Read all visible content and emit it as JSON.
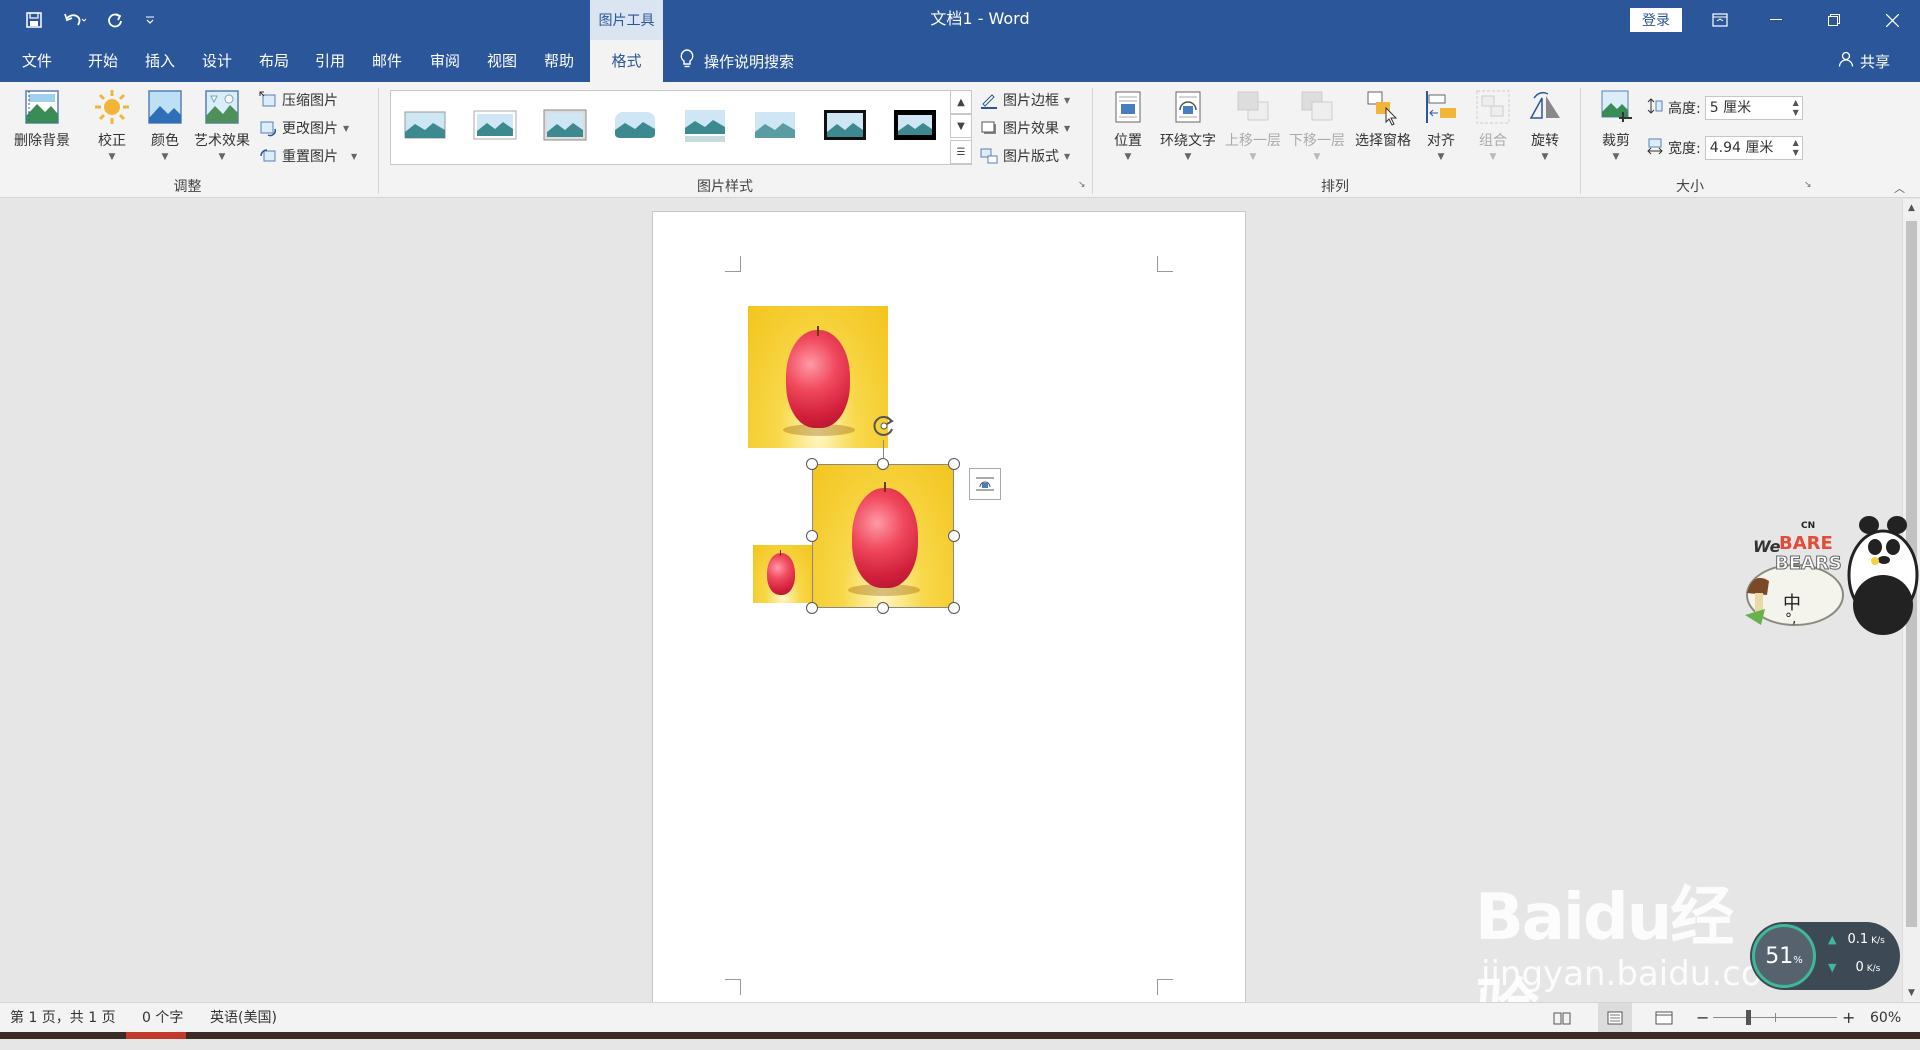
{
  "titlebar": {
    "context_tool_label": "图片工具",
    "doc_title": "文档1  -  Word",
    "login_label": "登录"
  },
  "tabs": [
    {
      "label": "文件"
    },
    {
      "label": "开始"
    },
    {
      "label": "插入"
    },
    {
      "label": "设计"
    },
    {
      "label": "布局"
    },
    {
      "label": "引用"
    },
    {
      "label": "邮件"
    },
    {
      "label": "审阅"
    },
    {
      "label": "视图"
    },
    {
      "label": "帮助"
    },
    {
      "label": "格式"
    }
  ],
  "tell_me": "操作说明搜索",
  "share": "共享",
  "ribbon": {
    "adjust": {
      "remove_bg": "删除背景",
      "correct": "校正",
      "color": "颜色",
      "art_effects": "艺术效果",
      "compress": "压缩图片",
      "change": "更改图片",
      "reset": "重置图片",
      "group_label": "调整"
    },
    "picture_styles": {
      "border": "图片边框",
      "effects": "图片效果",
      "layout": "图片版式",
      "group_label": "图片样式"
    },
    "arrange": {
      "position": "位置",
      "wrap_text": "环绕文字",
      "bring_forward": "上移一层",
      "send_backward": "下移一层",
      "selection_pane": "选择窗格",
      "align": "对齐",
      "group": "组合",
      "rotate": "旋转",
      "group_label": "排列"
    },
    "size": {
      "crop": "裁剪",
      "height_label": "高度:",
      "height_value": "5 厘米",
      "width_label": "宽度:",
      "width_value": "4.94 厘米",
      "group_label": "大小"
    }
  },
  "statusbar": {
    "page": "第 1 页，共 1 页",
    "words": "0 个字",
    "language": "英语(美国)",
    "zoom": "60%"
  },
  "overlays": {
    "ime_brand_top": "We",
    "ime_brand_1": "BARE",
    "ime_brand_2": "BEARS",
    "ime_badge": "CN",
    "ime_mode": "中",
    "ime_punct": "°,",
    "net_percent": "51",
    "net_percent_unit": "%",
    "net_up": "0.1",
    "net_up_unit": "K/s",
    "net_down": "0",
    "net_down_unit": "K/s",
    "watermark_main": "Baidu经验",
    "watermark_url": "jingyan.baidu.com"
  }
}
